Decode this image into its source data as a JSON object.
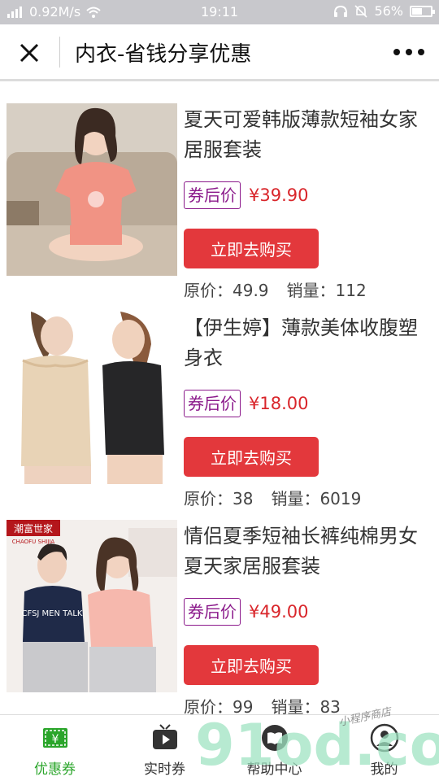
{
  "status_bar": {
    "network": "0.92M/s",
    "time": "19:11",
    "battery": "56%",
    "battery_level": 0.56
  },
  "header": {
    "title": "内衣-省钱分享优惠"
  },
  "products": [
    {
      "title": "夏天可爱韩版薄款短袖女家居服套装",
      "coupon_label": "券后价",
      "price": "¥39.90",
      "buy_label": "立即去购买",
      "original_price_label": "原价：",
      "original_price": "49.9",
      "sales_label": "销量：",
      "sales": "112"
    },
    {
      "title": "【伊生婷】薄款美体收腹塑身衣",
      "coupon_label": "券后价",
      "price": "¥18.00",
      "buy_label": "立即去购买",
      "original_price_label": "原价：",
      "original_price": "38",
      "sales_label": "销量：",
      "sales": "6019"
    },
    {
      "title": "情侣夏季短袖长裤纯棉男女夏天家居服套装",
      "coupon_label": "券后价",
      "price": "¥49.00",
      "buy_label": "立即去购买",
      "original_price_label": "原价：",
      "original_price": "99",
      "sales_label": "销量：",
      "sales": "83",
      "image_text": {
        "brand": "潮富世家",
        "brand_sub": "CHAOFU SHIJIA",
        "shirt_text": "CFSJ MEN TALK"
      }
    }
  ],
  "tabbar": {
    "tabs": [
      {
        "label": "优惠券",
        "icon": "coupon-icon",
        "active": true
      },
      {
        "label": "实时券",
        "icon": "play-tv-icon",
        "active": false
      },
      {
        "label": "帮助中心",
        "icon": "help-book-icon",
        "active": false
      },
      {
        "label": "我的",
        "icon": "user-icon",
        "active": false
      }
    ]
  },
  "watermark": {
    "text": "91od.com",
    "sub": "小程序商店"
  },
  "colors": {
    "accent_red": "#e3383c",
    "price_red": "#d9262b",
    "coupon_purple": "#8b1a8b",
    "tab_active_green": "#2aa52a",
    "status_bar_bg": "#c8c8cc"
  }
}
